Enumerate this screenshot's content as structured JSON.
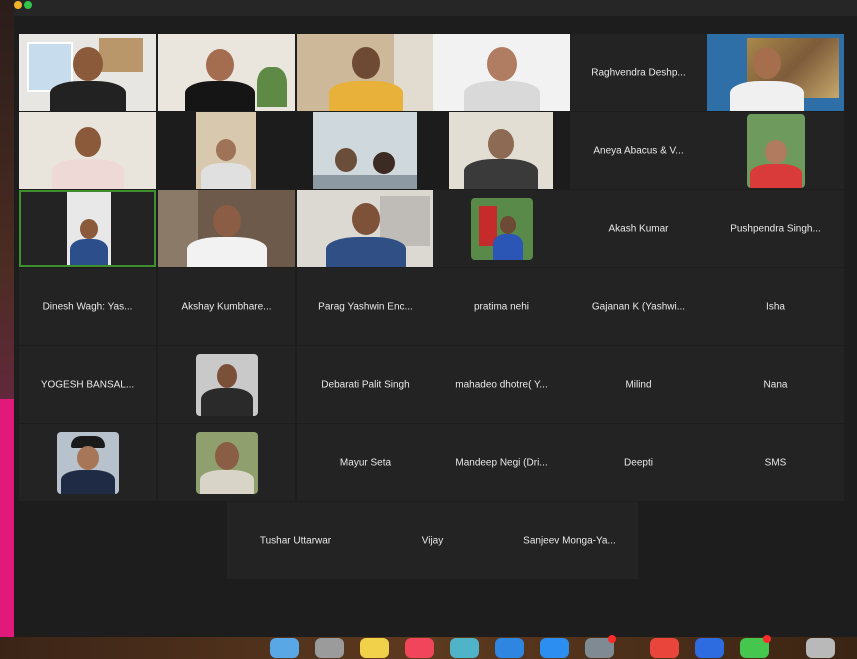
{
  "participants": {
    "raghvendra": "Raghvendra Deshp...",
    "aneya": "Aneya Abacus & V...",
    "akash": "Akash Kumar",
    "pushpendra": "Pushpendra Singh...",
    "dinesh": "Dinesh Wagh: Yas...",
    "akshay": "Akshay Kumbhare...",
    "parag": "Parag Yashwin Enc...",
    "pratima": "pratima nehi",
    "gajanan": "Gajanan K (Yashwi...",
    "isha": "Isha",
    "yogesh": "YOGESH BANSAL...",
    "debarati": "Debarati Palit Singh",
    "mahadeo": "mahadeo dhotre( Y...",
    "milind": "Milind",
    "nana": "Nana",
    "mayur": "Mayur Seta",
    "mandeep": "Mandeep Negi (Dri...",
    "deepti": "Deepti",
    "sms": "SMS",
    "tushar": "Tushar Uttarwar",
    "vijay": "Vijay",
    "sanjeev": "Sanjeev Monga-Ya..."
  },
  "colors": {
    "tile_bg": "#232323",
    "active_speaker_border": "#3f8f2f",
    "name_text": "#e9e9e9"
  },
  "dock": {
    "icons": [
      "finder-icon",
      "launchpad-icon",
      "notes-icon",
      "music-icon",
      "photos-icon",
      "facetime-icon",
      "app-store-icon",
      "system-prefs-icon",
      "chrome-icon",
      "zoom-icon",
      "messages-icon",
      "trash-icon"
    ]
  }
}
